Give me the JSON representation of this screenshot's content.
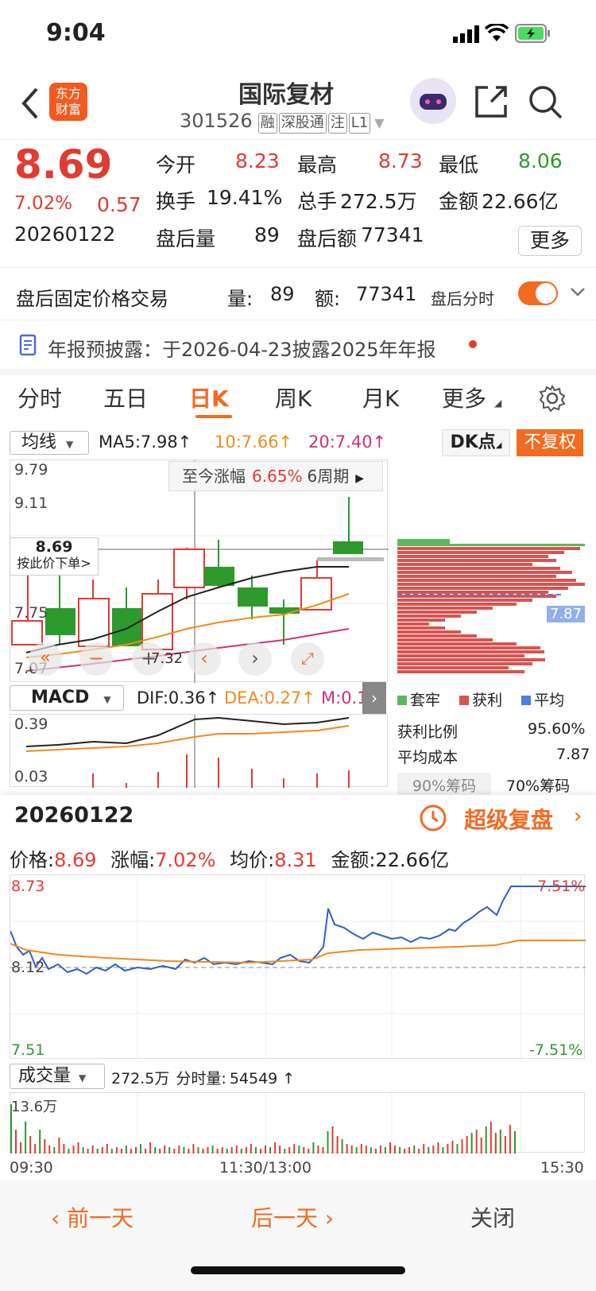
{
  "status": {
    "time": "9:04"
  },
  "header": {
    "title": "国际复材",
    "code": "301526",
    "tags": [
      "融",
      "深股通",
      "注",
      "L1"
    ],
    "logo_text": "东方\n财富"
  },
  "quote": {
    "price": "8.69",
    "pct": "7.02%",
    "chg": "0.57",
    "date": "20260122",
    "open_label": "今开",
    "open": "8.23",
    "high_label": "最高",
    "high": "8.73",
    "low_label": "最低",
    "low": "8.06",
    "turnover_label": "换手",
    "turnover": "19.41%",
    "vol_label": "总手",
    "vol": "272.5万",
    "amt_label": "金额",
    "amt": "22.66亿",
    "after_vol_label": "盘后量",
    "after_vol": "89",
    "after_amt_label": "盘后额",
    "after_amt": "77341",
    "more": "更多"
  },
  "fixed": {
    "label": "盘后固定价格交易",
    "vol_label": "量:",
    "vol": "89",
    "amt_label": "额:",
    "amt": "77341",
    "toggle_label": "盘后分时"
  },
  "notice": {
    "text": "年报预披露：于2026-04-23披露2025年年报"
  },
  "tabs": [
    "分时",
    "五日",
    "日K",
    "周K",
    "月K",
    "更多"
  ],
  "kline": {
    "ma_select": "均线",
    "ma5": "MA5:7.98↑",
    "ma10": "10:7.66↑",
    "ma20": "20:7.40↑",
    "dk": "DK点",
    "fq": "不复权",
    "y_labels": [
      "9.79",
      "9.11",
      "7.75",
      "7.07"
    ],
    "tip": "至今涨幅",
    "tip_pct": "6.65%",
    "tip_period": "6周期",
    "order_price": "8.69",
    "order_text": "按此价下单>",
    "low_mark": "7.32",
    "avg_cost_line": "7.87",
    "colors": {
      "up": "#e03c31",
      "down": "#2c9a2c"
    }
  },
  "macd": {
    "select": "MACD",
    "dif": "DIF:0.36↑",
    "dea": "DEA:0.27↑",
    "m": "M:0.1...",
    "y_top": "0.39",
    "y_bot": "0.03"
  },
  "chips": {
    "legend": [
      "套牢",
      "获利",
      "平均"
    ],
    "profit_label": "获利比例",
    "profit": "95.60%",
    "cost_label": "平均成本",
    "cost": "7.87",
    "tab90": "90%筹码",
    "tab70": "70%筹码"
  },
  "intraday": {
    "date": "20260122",
    "replay": "超级复盘",
    "price_label": "价格:",
    "price": "8.69",
    "pct_label": "涨幅:",
    "pct": "7.02%",
    "avg_label": "均价:",
    "avg": "8.31",
    "amt_label": "金额:",
    "amt": "22.66亿",
    "y_top": "8.73",
    "y_mid": "8.12",
    "y_bot": "7.51",
    "pct_top": "7.51%",
    "pct_bot": "-7.51%",
    "vol_select": "成交量",
    "vol_total": "272.5万",
    "fen_label": "分时量:",
    "fen_vol": "54549 ↑",
    "vol_max": "13.6万",
    "t_start": "09:30",
    "t_mid": "11:30/13:00",
    "t_end": "15:30"
  },
  "footer": {
    "prev": "前一天",
    "next": "后一天",
    "close": "关闭"
  }
}
